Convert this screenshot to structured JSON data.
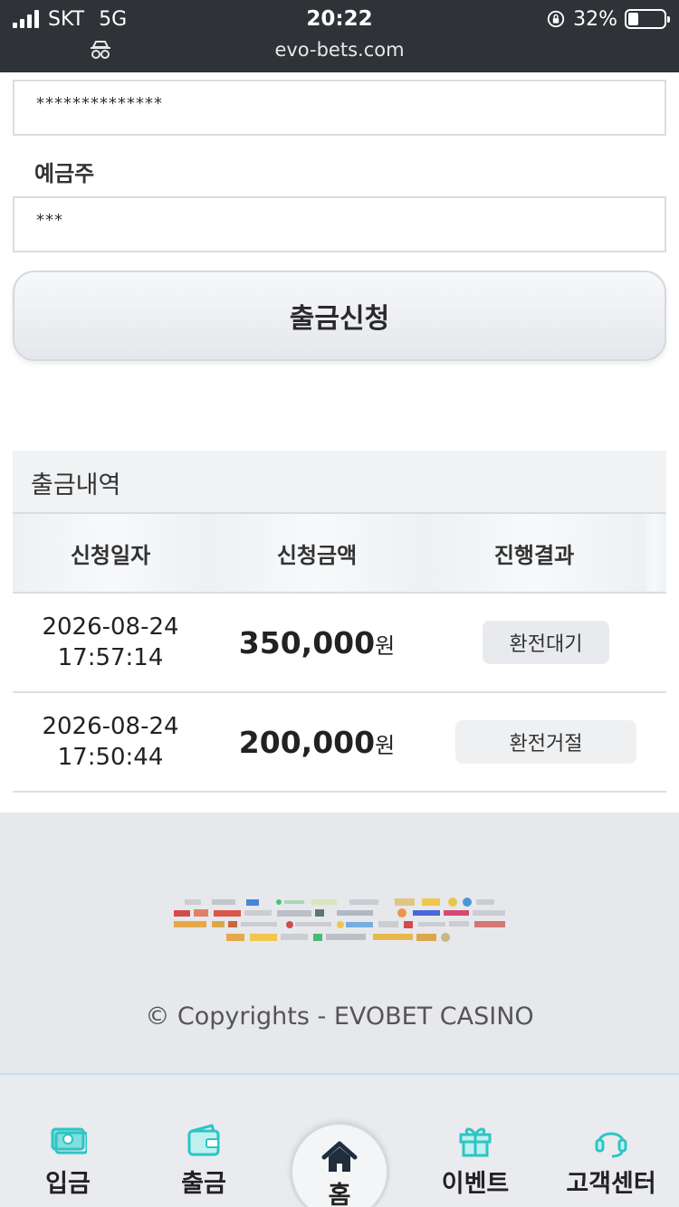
{
  "status_bar": {
    "carrier": "SKT",
    "network": "5G",
    "time": "20:22",
    "battery": "32%",
    "url": "evo-bets.com"
  },
  "form": {
    "account_value": "**************",
    "holder_label": "예금주",
    "holder_value": "***",
    "submit_label": "출금신청"
  },
  "history": {
    "title": "출금내역",
    "columns": [
      "신청일자",
      "신청금액",
      "진행결과"
    ],
    "rows": [
      {
        "date": "2026-08-24",
        "time": "17:57:14",
        "amount": "350,000",
        "unit": "원",
        "status": "환전대기"
      },
      {
        "date": "2026-08-24",
        "time": "17:50:44",
        "amount": "200,000",
        "unit": "원",
        "status": "환전거절"
      }
    ]
  },
  "footer": {
    "copyright": "© Copyrights - EVOBET CASINO"
  },
  "nav": {
    "deposit": "입금",
    "withdraw": "출금",
    "home": "홈",
    "event": "이벤트",
    "support": "고객센터"
  },
  "colors": {
    "accent": "#2ec4c4",
    "statusbar": "#2f3236"
  }
}
